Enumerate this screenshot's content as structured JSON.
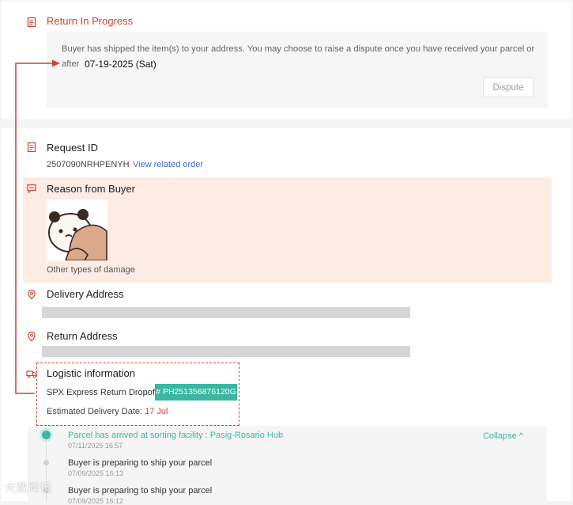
{
  "status": {
    "title": "Return In Progress",
    "message": "Buyer has shipped the item(s) to your address. You may choose to raise a dispute once you have received your parcel or",
    "after_label": "after",
    "after_date": "07-19-2025 (Sat)",
    "dispute_label": "Dispute"
  },
  "request": {
    "title": "Request ID",
    "id": "2507090NRHPENYH",
    "link_label": "View related order"
  },
  "reason": {
    "title": "Reason from Buyer",
    "caption": "Other types of damage"
  },
  "delivery_address": {
    "title": "Delivery Address"
  },
  "return_address": {
    "title": "Return Address"
  },
  "logistic": {
    "title": "Logistic information",
    "courier": "SPX Express Return Dropoff",
    "tracking": "# PH251356876120G",
    "est_label": "Estimated Delivery Date:",
    "est_date": "17 Jul"
  },
  "timeline": {
    "collapse_label": "Collapse ^",
    "events": [
      {
        "title": "Parcel has arrived at sorting facility : Pasig-Rosario Hub",
        "time": "07/11/2025 16:57"
      },
      {
        "title": "Buyer is preparing to ship your parcel",
        "time": "07/09/2025 16:13"
      },
      {
        "title": "Buyer is preparing to ship your parcel",
        "time": "07/09/2025 16:12"
      }
    ]
  },
  "watermark": "大数跨境",
  "colors": {
    "accent": "#d0422f",
    "teal": "#3ab7a0",
    "link": "#3f6bd6",
    "highlight_bg": "#fdece3"
  }
}
